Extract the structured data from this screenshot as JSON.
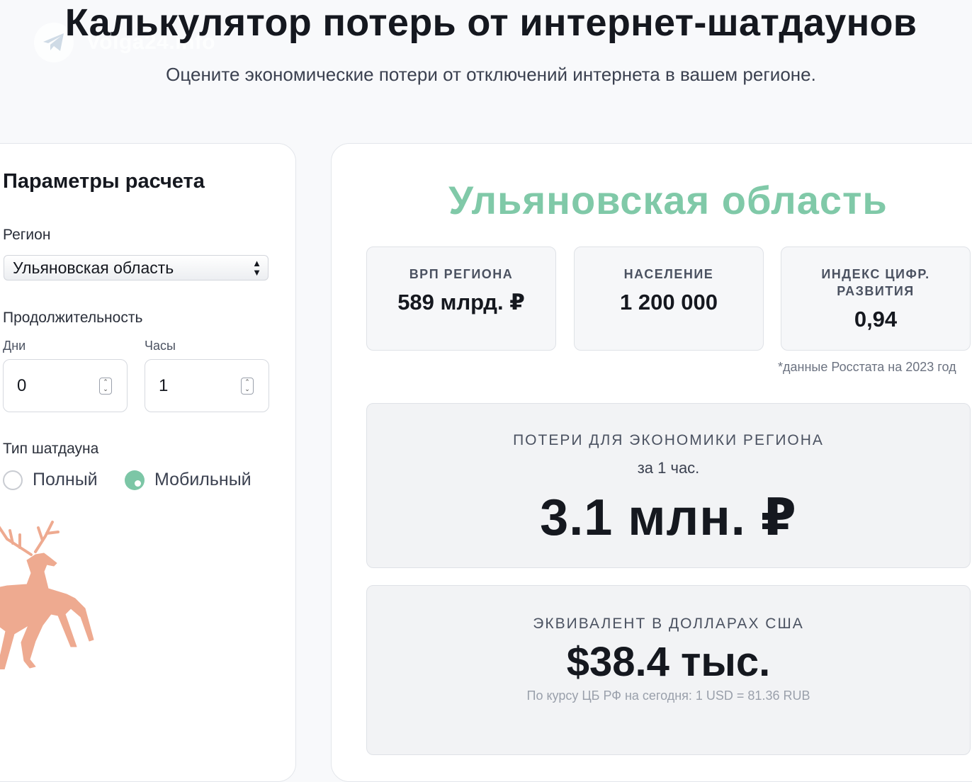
{
  "watermark": {
    "text": "Volga24.info",
    "icon": "telegram-icon"
  },
  "header": {
    "title": "Калькулятор потерь от интернет-шатдаунов",
    "subtitle": "Оцените экономические потери от отключений интернета в вашем регионе."
  },
  "params": {
    "title": "Параметры расчета",
    "region_label": "Регион",
    "region_selected": "Ульяновская область",
    "duration_label": "Продолжительность",
    "days_label": "Дни",
    "days_value": "0",
    "hours_label": "Часы",
    "hours_value": "1",
    "type_label": "Тип шатдауна",
    "type_options": [
      {
        "label": "Полный",
        "selected": false
      },
      {
        "label": "Мобильный",
        "selected": true
      }
    ],
    "decoration": "deer-emblem"
  },
  "result": {
    "region_name": "Ульяновская область",
    "stats": [
      {
        "label": "ВРП РЕГИОНА",
        "value": "589 млрд. ₽"
      },
      {
        "label": "НАСЕЛЕНИЕ",
        "value": "1 200 000"
      },
      {
        "label": "ИНДЕКС ЦИФР. РАЗВИТИЯ",
        "value": "0,94"
      }
    ],
    "footnote": "*данные Росстата на 2023 год",
    "loss": {
      "label": "ПОТЕРИ ДЛЯ ЭКОНОМИКИ РЕГИОНА",
      "period": "за 1 час.",
      "value": "3.1 млн. ₽"
    },
    "usd": {
      "label": "ЭКВИВАЛЕНТ В ДОЛЛАРАХ США",
      "value": "$38.4 тыс.",
      "rate": "По курсу ЦБ РФ на сегодня: 1 USD = 81.36 RUB"
    }
  },
  "colors": {
    "accent": "#80c9a8",
    "radio_on": "#7cc6a6",
    "deer": "#eeaa90",
    "background": "#f8f9fb"
  }
}
